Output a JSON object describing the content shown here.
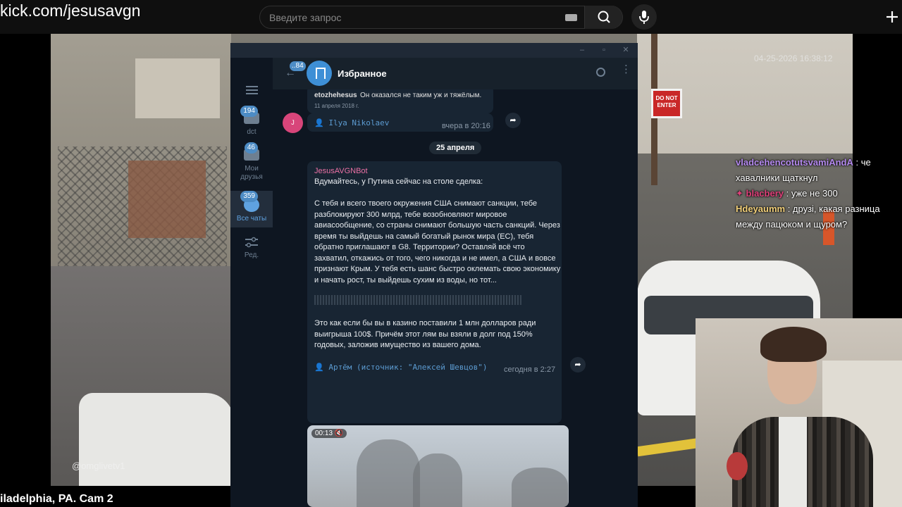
{
  "browser": {
    "url_text": "kick.com/jesusavgn",
    "search_placeholder": "Введите запрос"
  },
  "stream": {
    "timestamp": "04-25-2026 16:38:12",
    "watermark": "@omglivetv1",
    "camera_label": "iladelphia, PA. Cam 2",
    "sign_text": "DO NOT ENTER"
  },
  "telegram": {
    "sidebar": [
      {
        "label": "dct",
        "badge": "194"
      },
      {
        "label": "Мои друзья",
        "badge": "46"
      },
      {
        "label": "Все чаты",
        "badge": "359"
      },
      {
        "label": "Ред.",
        "badge": ""
      }
    ],
    "header": {
      "back_badge": "..84",
      "title": "Избранное"
    },
    "forwarded": {
      "sender": "etozhehesus",
      "text": "Он оказался не таким уж и тяжёлым.",
      "date": "11 апреля 2018 г."
    },
    "msg1": {
      "avatar_letter": "J",
      "source": "👤 Ilya Nikolaev",
      "time": "вчера в 20:16"
    },
    "date_separator": "25 апреля",
    "msg2": {
      "bot_name": "JesusAVGNBot",
      "para1": "Вдумайтесь, у Путина сейчас на столе сделка:",
      "para2": "С тебя и всего твоего окружения США снимают санкции, тебе разблокируют 300 млрд, тебе возобновляют мировое авиасообщение, со страны снимают большую часть санкций. Через время ты выйдешь на самый богатый рынок мира (ЕС), тебя обратно приглашают в G8. Территории? Оставляй всё что захватил, откажись от того, чего никогда и не имел, а США и вовсе признают Крым. У тебя есть шанс быстро оклемать свою экономику и начать рост, ты выйдешь сухим из воды, но тот...",
      "para3": "Это как если бы вы в казино поставили 1 млн долларов ради выигрыша 100$. Причём этот лям вы взяли в долг под 150% годовых, заложив имущество из вашего дома.",
      "source": "👤 Артём (источник: \"Алексей Шевцов\")",
      "time": "сегодня в 2:27"
    },
    "video": {
      "duration": "00:13"
    }
  },
  "chat_messages": [
    {
      "user": "vladcehencotutsvamiAndA",
      "text": " : че хавалники щаткнул",
      "color": "#b58af0"
    },
    {
      "user": "blacbery",
      "text": " : уже не 300",
      "color": "#e0407a"
    },
    {
      "user": "Hdeyaumm",
      "text": " : друзі, какая разница между пацюком и щуром?",
      "color": "#f2d07a"
    }
  ],
  "icons": [
    "search-icon",
    "keyboard-icon",
    "mic-icon",
    "plus-icon",
    "menu-icon",
    "back-icon",
    "bookmark-icon",
    "share-icon",
    "mute-icon"
  ]
}
